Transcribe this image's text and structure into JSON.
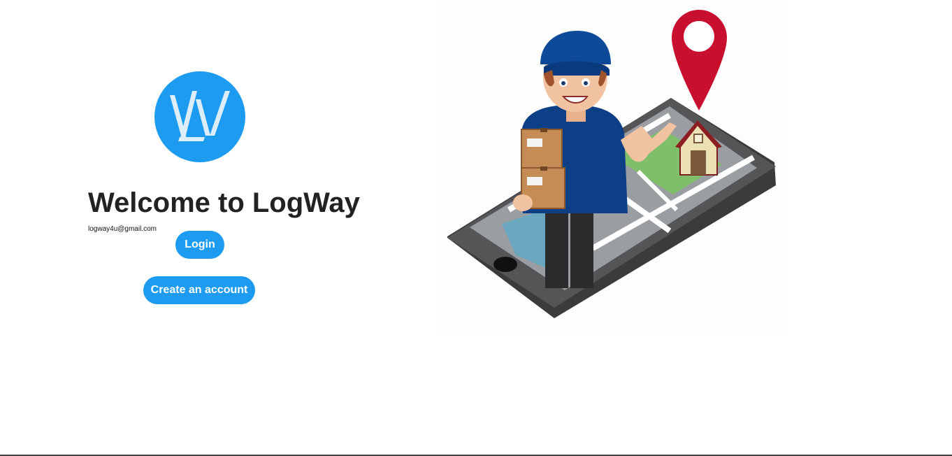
{
  "brand": {
    "logo_icon": "logway-monogram-icon",
    "logo_color": "#1d9bf0"
  },
  "welcome": {
    "title": "Welcome to LogWay",
    "email": "logway4u@gmail.com"
  },
  "actions": {
    "login_label": "Login",
    "create_account_label": "Create an account",
    "button_color": "#1d9bf0"
  },
  "illustration": {
    "icon": "delivery-man-on-phone-map-illustration",
    "pin_color": "#c8102e"
  }
}
